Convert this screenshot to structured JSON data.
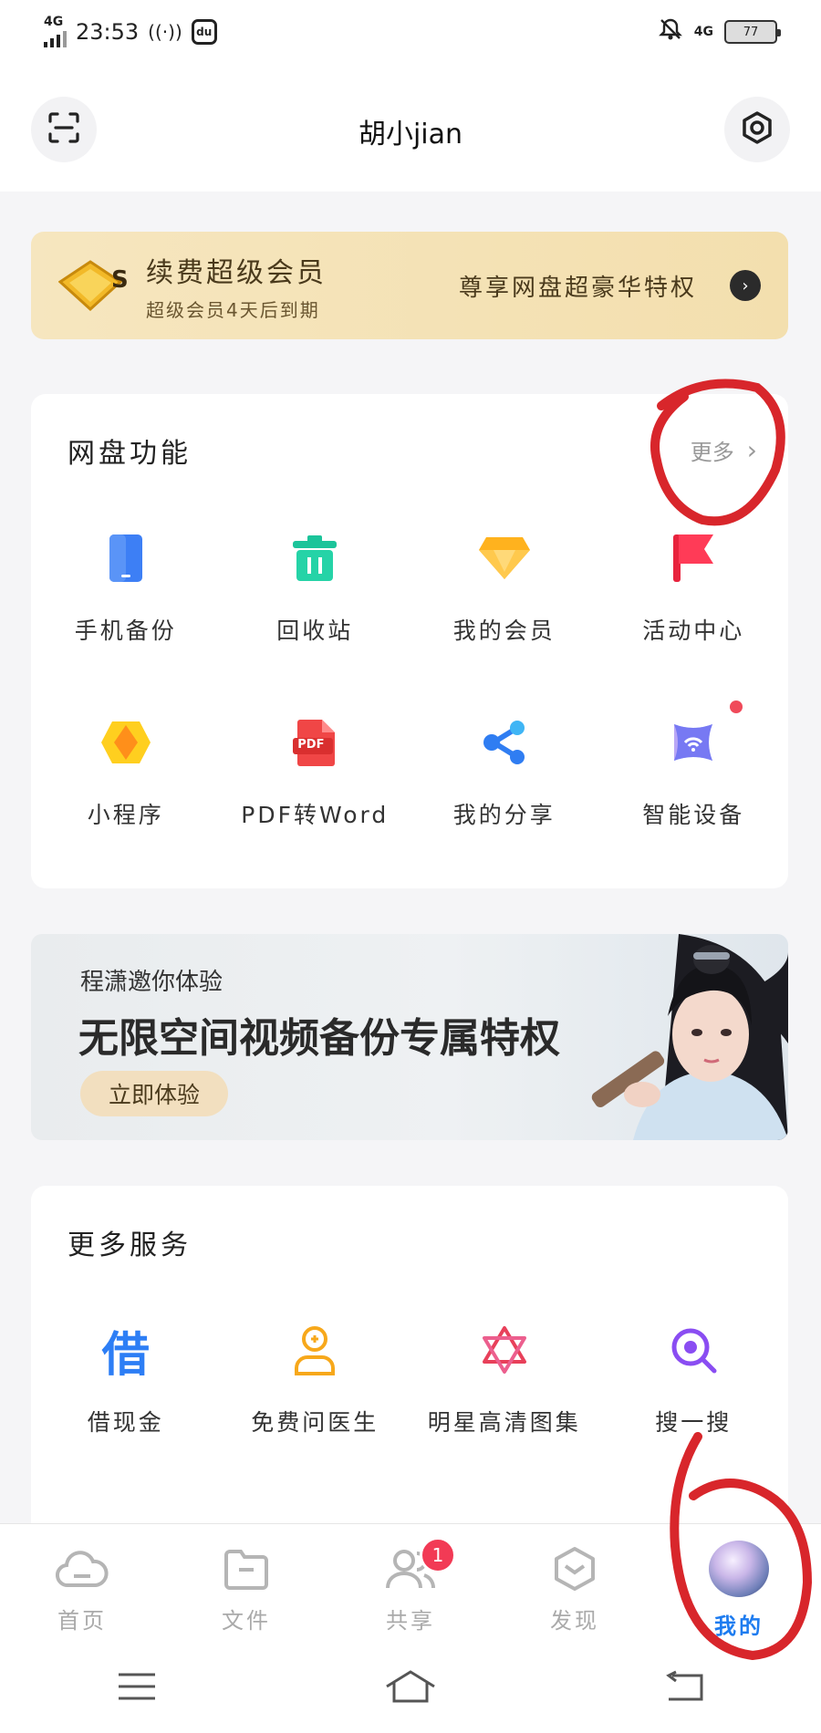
{
  "status_bar": {
    "network": "4G",
    "time": "23:53",
    "app_badge": "du",
    "right_network": "4G",
    "battery": "77"
  },
  "header": {
    "username": "胡小jian"
  },
  "vip_banner": {
    "title": "续费超级会员",
    "subtitle": "超级会员4天后到期",
    "privilege_text": "尊享网盘超豪华特权",
    "badge_letter": "S"
  },
  "features": {
    "title": "网盘功能",
    "more_label": "更多",
    "items": [
      {
        "label": "手机备份",
        "icon": "phone-backup-icon"
      },
      {
        "label": "回收站",
        "icon": "recycle-bin-icon"
      },
      {
        "label": "我的会员",
        "icon": "diamond-icon"
      },
      {
        "label": "活动中心",
        "icon": "flag-icon"
      },
      {
        "label": "小程序",
        "icon": "mini-program-icon"
      },
      {
        "label": "PDF转Word",
        "icon": "pdf-icon"
      },
      {
        "label": "我的分享",
        "icon": "share-icon"
      },
      {
        "label": "智能设备",
        "icon": "smart-device-icon"
      }
    ],
    "pdf_badge": "PDF"
  },
  "promo": {
    "small_text": "程潇邀你体验",
    "big_text": "无限空间视频备份专属特权",
    "button_label": "立即体验"
  },
  "services": {
    "title": "更多服务",
    "items": [
      {
        "label": "借现金",
        "icon": "cash-loan-icon",
        "glyph": "借"
      },
      {
        "label": "免费问医生",
        "icon": "doctor-icon"
      },
      {
        "label": "明星高清图集",
        "icon": "star-gallery-icon"
      },
      {
        "label": "搜一搜",
        "icon": "search-icon"
      }
    ]
  },
  "tabbar": {
    "tabs": [
      {
        "label": "首页",
        "icon": "cloud-home-icon"
      },
      {
        "label": "文件",
        "icon": "folder-icon"
      },
      {
        "label": "共享",
        "icon": "people-icon",
        "badge": "1"
      },
      {
        "label": "发现",
        "icon": "discover-icon"
      },
      {
        "label": "我的",
        "icon": "avatar"
      }
    ],
    "active": "我的"
  },
  "colors": {
    "accent": "#1e7cf0",
    "badge_red": "#f23a55",
    "vip_gold": "#f3dfae",
    "annotation_red": "#d8262b"
  }
}
